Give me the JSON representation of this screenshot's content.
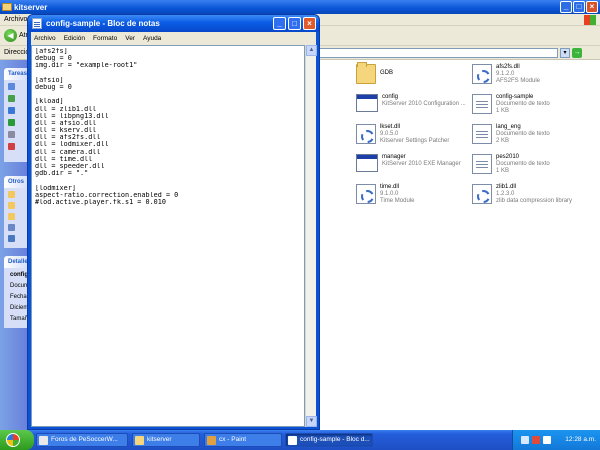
{
  "explorer": {
    "title": "kitserver",
    "menu_first": "Archivo",
    "back_label": "Atrás",
    "address_label": "Dirección",
    "go_label": "Ir",
    "taskpane": {
      "panel1": "Tareas",
      "panel2": "Otros",
      "panel3": "Detalles",
      "details": [
        {
          "text": "config",
          "bold": true
        },
        {
          "text": "Docume",
          "bold": false
        },
        {
          "text": "Fecha",
          "bold": false
        },
        {
          "text": "Diciem",
          "bold": false
        },
        {
          "text": "Tamañ",
          "bold": false
        }
      ]
    },
    "files": [
      {
        "name": "GDB",
        "line2": "",
        "line3": "",
        "icon": "folder-icon"
      },
      {
        "name": "afs2fs.dll",
        "line2": "9.1.2.0",
        "line3": "AFS2FS Module",
        "icon": "dll-icon"
      },
      {
        "name": "config",
        "line2": "KitServer 2010 Configuration ...",
        "line3": "",
        "icon": "exe-window-icon"
      },
      {
        "name": "config-sample",
        "line2": "Documento de texto",
        "line3": "1 KB",
        "icon": "text-document-icon"
      },
      {
        "name": "lkset.dll",
        "line2": "9.0.5.0",
        "line3": "Kitserver Settings Patcher",
        "icon": "dll-icon"
      },
      {
        "name": "lang_eng",
        "line2": "Documento de texto",
        "line3": "2 KB",
        "icon": "text-document-icon"
      },
      {
        "name": "manager",
        "line2": "KitServer 2010 EXE Manager",
        "line3": "",
        "icon": "exe-window-icon"
      },
      {
        "name": "pes2010",
        "line2": "Documento de texto",
        "line3": "1 KB",
        "icon": "text-document-icon"
      },
      {
        "name": "time.dll",
        "line2": "9.1.0.0",
        "line3": "Time Module",
        "icon": "dll-icon"
      },
      {
        "name": "zlib1.dll",
        "line2": "1.2.3.0",
        "line3": "zlib data compression library",
        "icon": "dll-icon"
      }
    ]
  },
  "notepad": {
    "title": "config-sample - Bloc de notas",
    "menu": [
      "Archivo",
      "Edición",
      "Formato",
      "Ver",
      "Ayuda"
    ],
    "lines": [
      "[afs2fs]",
      "debug = 0",
      "img.dir = \"example-root1\"",
      "",
      "[afsio]",
      "debug = 0",
      "",
      "[kload]",
      "dll = zlib1.dll",
      "dll = libpng13.dll",
      "dll = afsio.dll",
      "dll = kserv.dll",
      "dll = afs2fs.dll",
      "dll = lodmixer.dll",
      "dll = camera.dll",
      "dll = time.dll",
      "dll = speeder.dll",
      "gdb.dir = \".\"",
      "",
      "[lodmixer]",
      "aspect-ratio.correction.enabled = 0",
      "#lod.active.player.fk.s1 = 0.010"
    ]
  },
  "taskbar": {
    "buttons": [
      {
        "label": "Foros de PeSoccerW...",
        "active": false,
        "icon_color": "#e8e8e8"
      },
      {
        "label": "kitserver",
        "active": false,
        "icon_color": "#f6d67c"
      },
      {
        "label": "cx - Paint",
        "active": false,
        "icon_color": "#e0a040"
      },
      {
        "label": "config-sample - Bloc d...",
        "active": true,
        "icon_color": "#ffffff"
      }
    ],
    "clock": "12:28 a.m."
  }
}
